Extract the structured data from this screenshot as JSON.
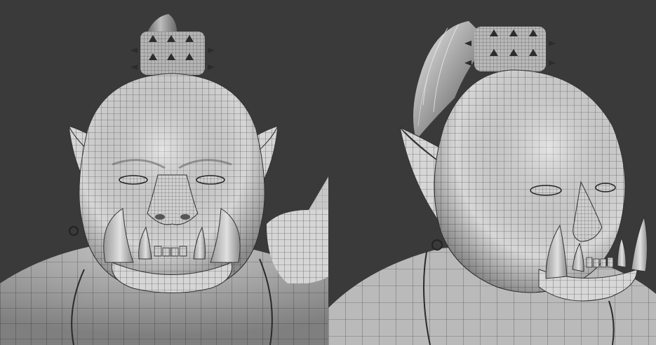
{
  "scene": {
    "background_color": "#3a3a3a",
    "mesh_fill_color": "#d9d9d9",
    "wire_color": "#2a2a2a",
    "views": [
      {
        "name": "front-view",
        "subject": "orc-head-wireframe"
      },
      {
        "name": "three-quarter-view",
        "subject": "orc-head-wireframe"
      }
    ]
  }
}
